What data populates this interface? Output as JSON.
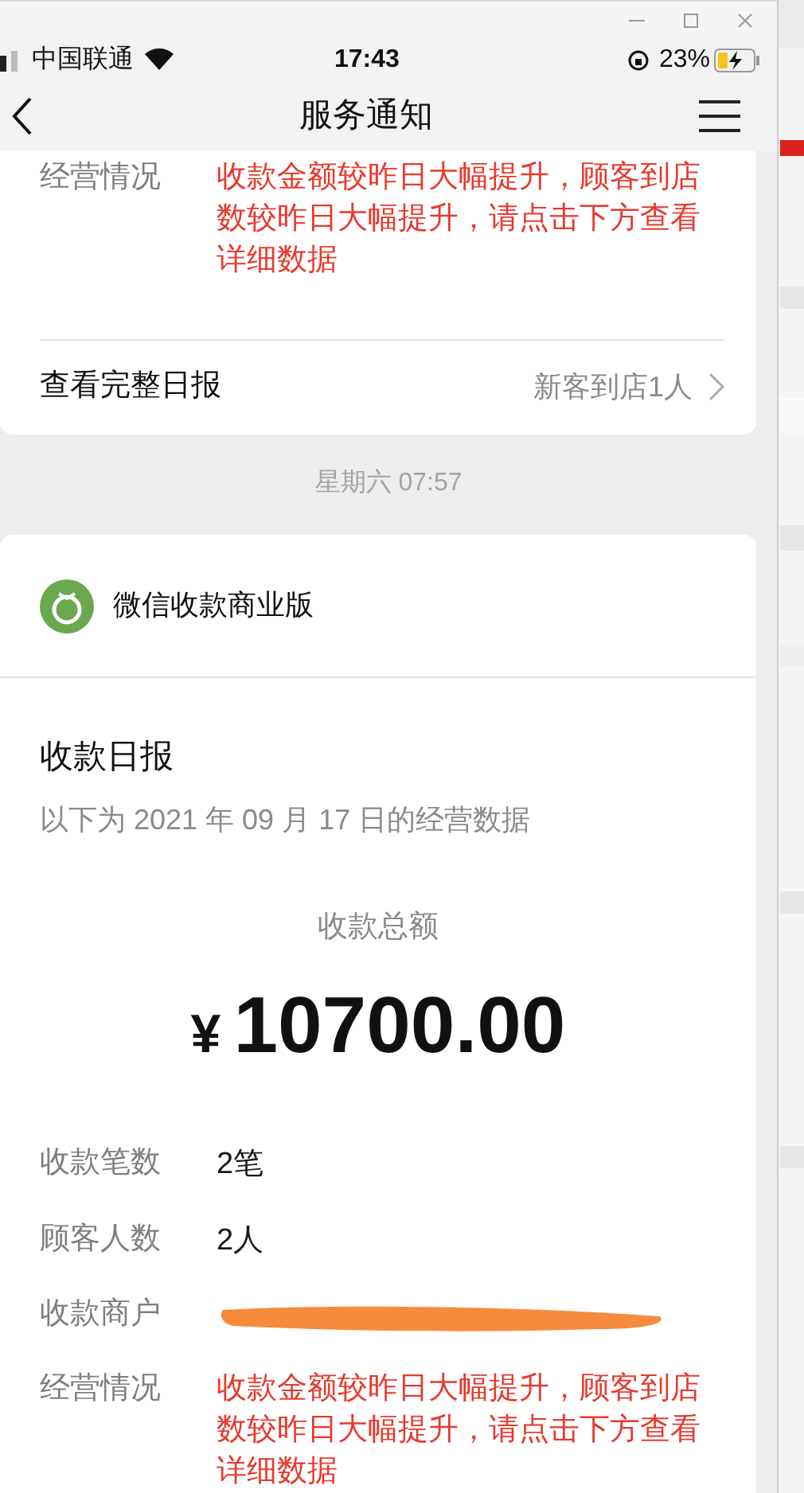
{
  "status_bar": {
    "carrier": "中国联通",
    "time": "17:43",
    "battery": "23%"
  },
  "nav_bar": {
    "title": "服务通知"
  },
  "previous_card": {
    "rows": [
      {
        "label": "经营情况",
        "value": "收款金额较昨日大幅提升，顾客到店数较昨日大幅提升，请点击下方查看详细数据",
        "kind": "alert"
      }
    ],
    "link": {
      "label": "查看完整日报",
      "detail": "新客到店1人"
    }
  },
  "timestamp": "星期六 07:57",
  "card": {
    "app_name": "微信收款商业版",
    "title": "收款日报",
    "subtitle": "以下为 2021 年 09 月 17 日的经营数据",
    "total_label": "收款总额",
    "currency": "¥",
    "amount": "10700.00",
    "rows": [
      {
        "label": "收款笔数",
        "value": "2笔",
        "kind": "text"
      },
      {
        "label": "顾客人数",
        "value": "2人",
        "kind": "text"
      },
      {
        "label": "收款商户",
        "kind": "redacted"
      },
      {
        "label": "经营情况",
        "value": "收款金额较昨日大幅提升，顾客到店数较昨日大幅提升，请点击下方查看详细数据",
        "kind": "alert"
      }
    ]
  }
}
